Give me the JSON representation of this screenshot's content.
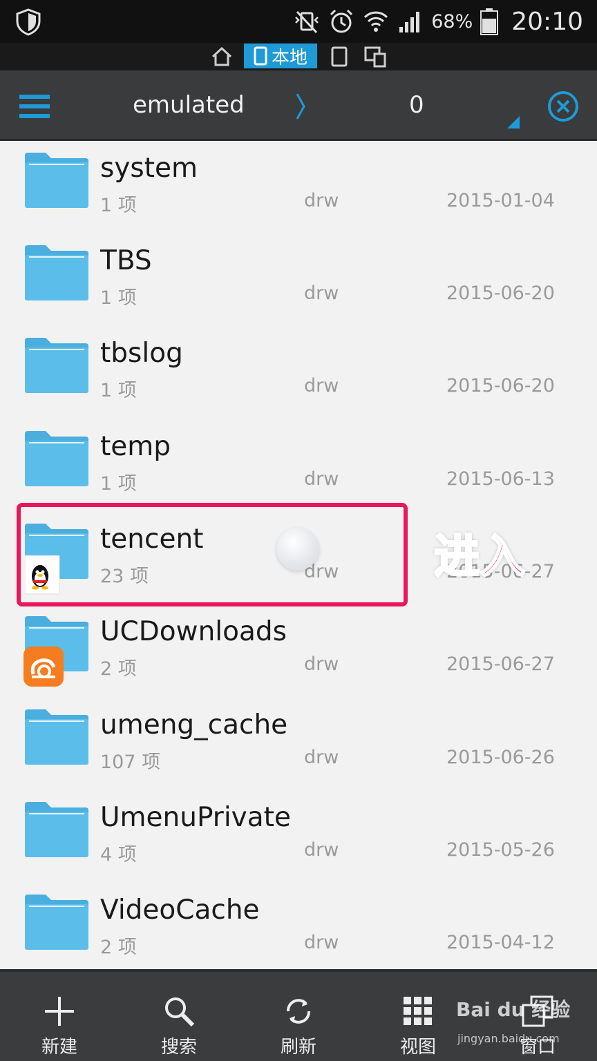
{
  "status_bar": {
    "battery_percent": "68%",
    "time": "20:10"
  },
  "tabs": {
    "local_label": "本地"
  },
  "path": {
    "segments": [
      "emulated",
      "0"
    ]
  },
  "colors": {
    "accent": "#1e9ad6",
    "folder": "#5bbde9",
    "highlight": "#e8175d"
  },
  "files": [
    {
      "name": "system",
      "count": "1 项",
      "perm": "drw",
      "date": "2015-01-04"
    },
    {
      "name": "TBS",
      "count": "1 项",
      "perm": "drw",
      "date": "2015-06-20"
    },
    {
      "name": "tbslog",
      "count": "1 项",
      "perm": "drw",
      "date": "2015-06-20"
    },
    {
      "name": "temp",
      "count": "1 项",
      "perm": "drw",
      "date": "2015-06-13"
    },
    {
      "name": "tencent",
      "count": "23 项",
      "perm": "drw",
      "date": "2015-06-27",
      "badge": "qq-penguin-icon"
    },
    {
      "name": "UCDownloads",
      "count": "2 项",
      "perm": "drw",
      "date": "2015-06-27",
      "badge": "uc-browser-icon"
    },
    {
      "name": "umeng_cache",
      "count": "107 项",
      "perm": "drw",
      "date": "2015-06-26"
    },
    {
      "name": "UmenuPrivate",
      "count": "4 项",
      "perm": "drw",
      "date": "2015-05-26"
    },
    {
      "name": "VideoCache",
      "count": "2 项",
      "perm": "drw",
      "date": "2015-04-12"
    }
  ],
  "annotation": "进入",
  "toolbar": [
    {
      "label": "新建",
      "icon": "plus-icon"
    },
    {
      "label": "搜索",
      "icon": "search-icon"
    },
    {
      "label": "刷新",
      "icon": "refresh-icon"
    },
    {
      "label": "视图",
      "icon": "grid-view-icon"
    },
    {
      "label": "窗口",
      "icon": "windows-icon"
    }
  ],
  "watermark": {
    "brand": "Bai du 经验",
    "url": "jingyan.baidu.com"
  }
}
